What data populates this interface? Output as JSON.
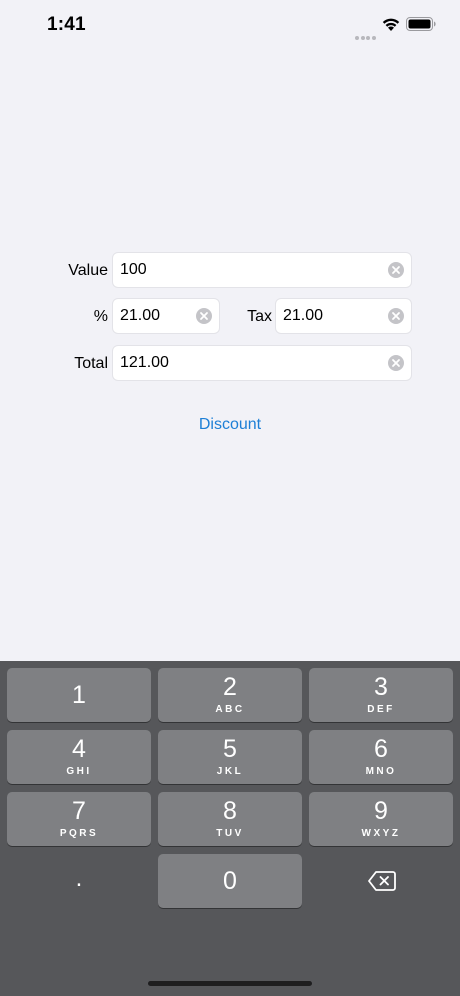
{
  "status_bar": {
    "time": "1:41"
  },
  "form": {
    "value": {
      "label": "Value",
      "text": "100"
    },
    "percent": {
      "label": "%",
      "text": "21.00"
    },
    "tax": {
      "label": "Tax",
      "text": "21.00"
    },
    "total": {
      "label": "Total",
      "text": "121.00"
    },
    "discount_label": "Discount"
  },
  "keyboard": {
    "keys": [
      {
        "digit": "1",
        "letters": ""
      },
      {
        "digit": "2",
        "letters": "ABC"
      },
      {
        "digit": "3",
        "letters": "DEF"
      },
      {
        "digit": "4",
        "letters": "GHI"
      },
      {
        "digit": "5",
        "letters": "JKL"
      },
      {
        "digit": "6",
        "letters": "MNO"
      },
      {
        "digit": "7",
        "letters": "PQRS"
      },
      {
        "digit": "8",
        "letters": "TUV"
      },
      {
        "digit": "9",
        "letters": "WXYZ"
      },
      {
        "digit": "0",
        "letters": ""
      }
    ],
    "decimal": ".",
    "delete_icon": "backspace-icon"
  },
  "colors": {
    "accent": "#1d7fd6",
    "background": "#f2f2f7",
    "keyboard_bg": "#56575a",
    "key_bg": "#7f8083"
  }
}
